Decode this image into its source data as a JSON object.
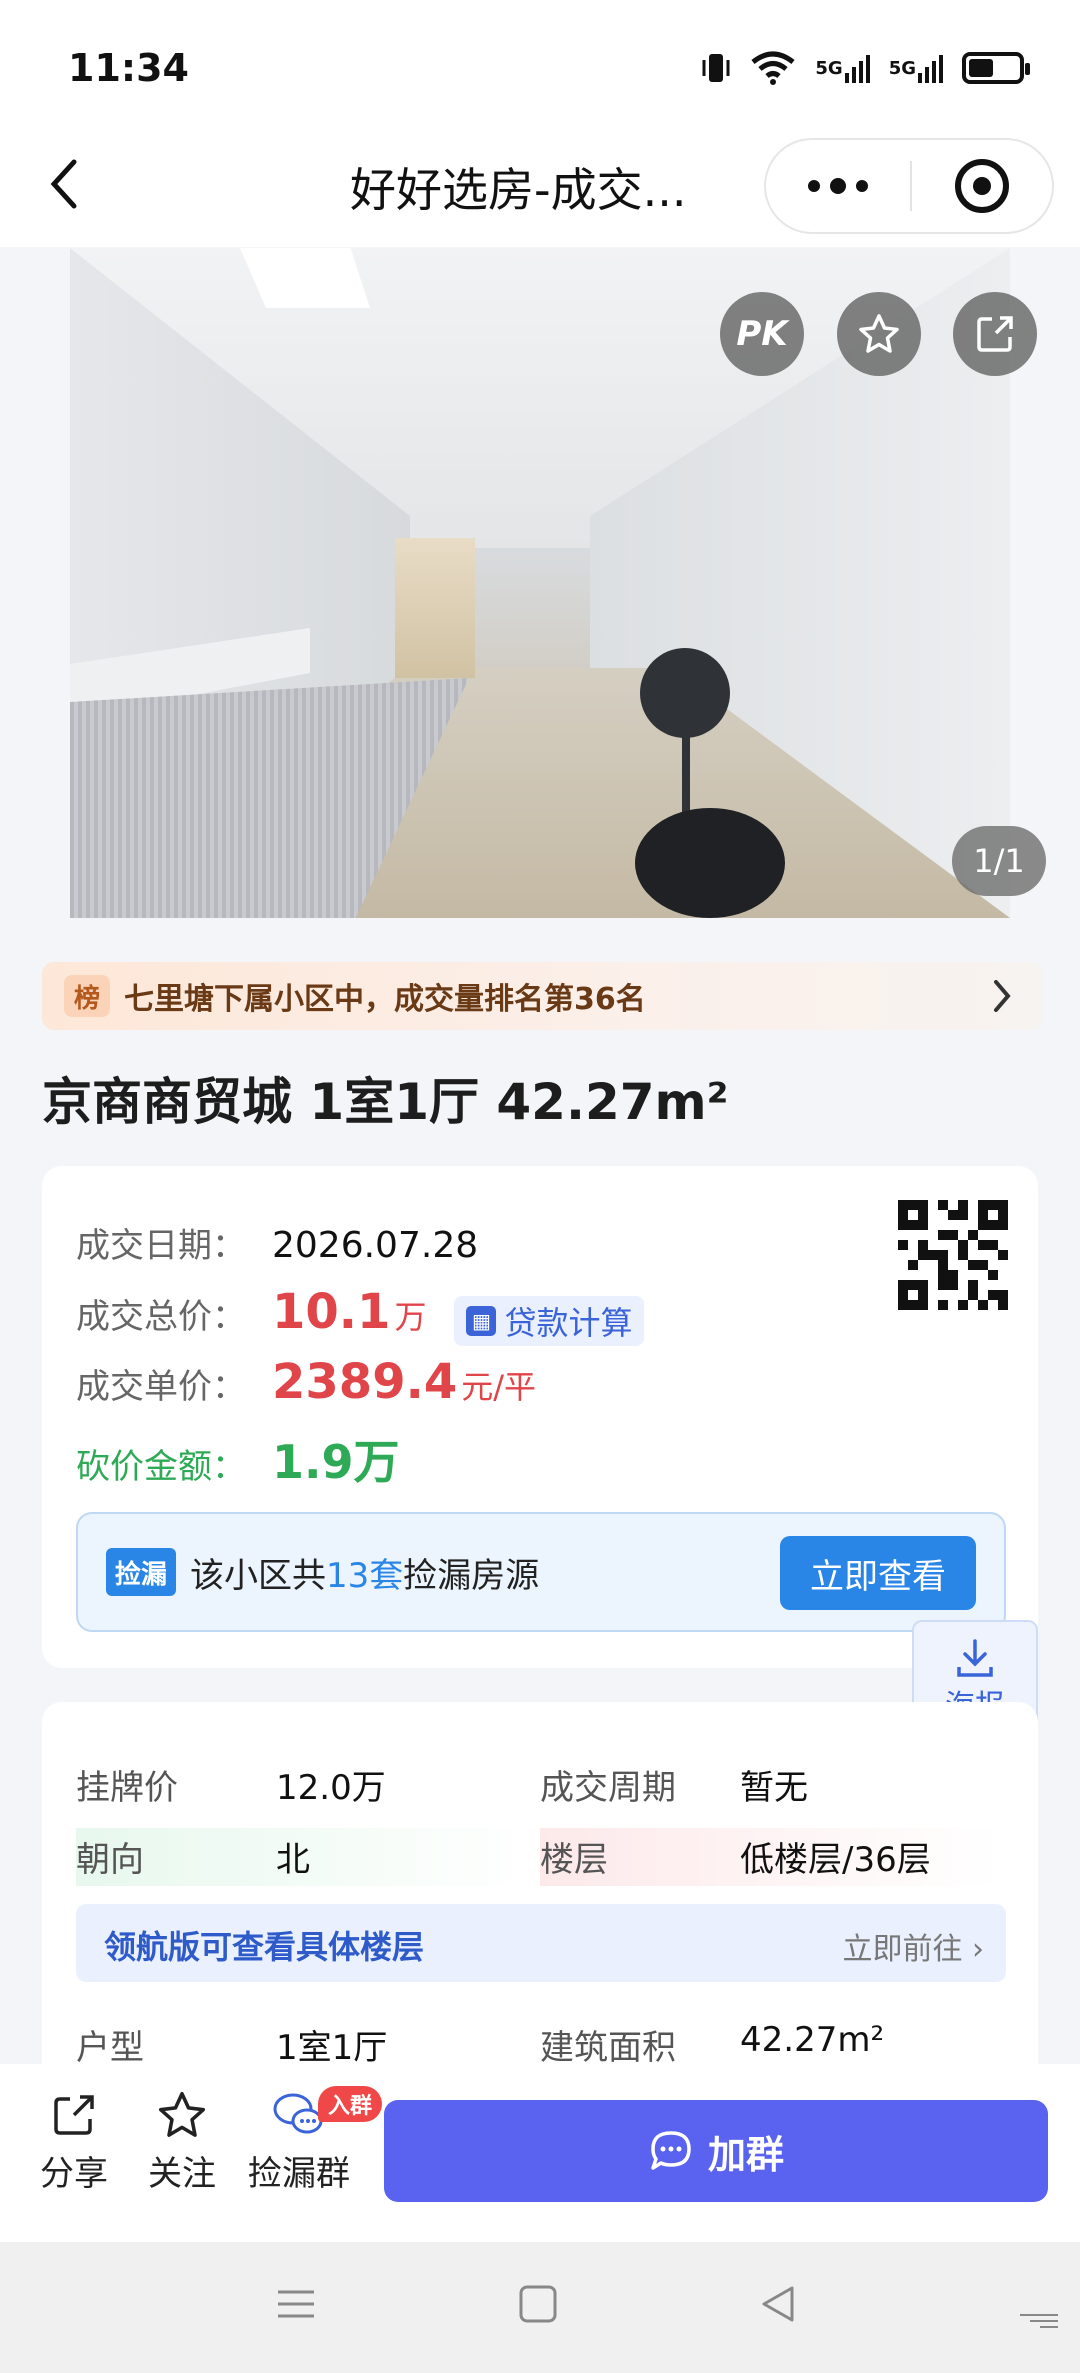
{
  "status_bar": {
    "time": "11:34",
    "network_1": "5G",
    "network_2": "5G"
  },
  "nav": {
    "title": "好好选房-成交..."
  },
  "photo": {
    "pk_label": "PK",
    "counter": "1/1"
  },
  "ranking": {
    "badge": "榜",
    "text": "七里塘下属小区中，成交量排名第36名"
  },
  "house": {
    "title": "京商商贸城 1室1厅 42.27m²"
  },
  "deal": {
    "date_label": "成交日期：",
    "date_value": "2026.07.28",
    "total_label": "成交总价：",
    "total_value": "10.1",
    "total_unit": "万",
    "loan_button": "贷款计算",
    "unit_label": "成交单价：",
    "unit_value": "2389.4",
    "unit_unit": "元/平",
    "bargain_label": "砍价金额：",
    "bargain_value": "1.9万"
  },
  "leak": {
    "tag": "捡漏",
    "text_prefix": "该小区共",
    "count": "13套",
    "text_suffix": "捡漏房源",
    "button": "立即查看"
  },
  "poster": {
    "label": "海报"
  },
  "details": {
    "listing_price_label": "挂牌价",
    "listing_price_value": "12.0万",
    "cycle_label": "成交周期",
    "cycle_value": "暂无",
    "orientation_label": "朝向",
    "orientation_value": "北",
    "floor_label": "楼层",
    "floor_value": "低楼层/36层",
    "navigator_text": "领航版可查看具体楼层",
    "navigator_link": "立即前往",
    "layout_label": "户型",
    "layout_value": "1室1厅",
    "area_label": "建筑面积",
    "area_value": "42.27m²"
  },
  "bottom_bar": {
    "share": "分享",
    "follow": "关注",
    "group": "捡漏群",
    "group_badge": "入群",
    "join_button": "加群"
  },
  "colors": {
    "price_red": "#e0454a",
    "bargain_green": "#2eaa56",
    "leak_blue": "#2a86e6",
    "join_purple": "#5a63f0"
  }
}
